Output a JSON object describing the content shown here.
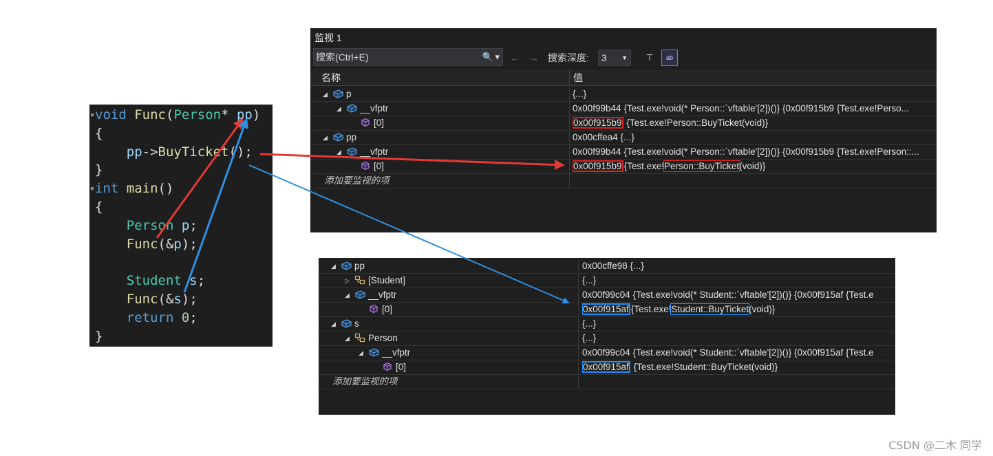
{
  "code": {
    "lines": [
      [
        {
          "t": "void",
          "c": "kw"
        },
        {
          "t": " ",
          "c": "pl"
        },
        {
          "t": "Func",
          "c": "fn"
        },
        {
          "t": "(",
          "c": "pl"
        },
        {
          "t": "Person",
          "c": "ty"
        },
        {
          "t": "* ",
          "c": "pl"
        },
        {
          "t": "pp",
          "c": "vr"
        },
        {
          "t": ")",
          "c": "pl"
        }
      ],
      [
        {
          "t": "{",
          "c": "pl"
        }
      ],
      [
        {
          "t": "    ",
          "c": "pl"
        },
        {
          "t": "pp",
          "c": "vr"
        },
        {
          "t": "->",
          "c": "pl"
        },
        {
          "t": "BuyTicket",
          "c": "fn"
        },
        {
          "t": "();",
          "c": "pl"
        }
      ],
      [
        {
          "t": "}",
          "c": "pl"
        }
      ],
      [
        {
          "t": "int",
          "c": "kw"
        },
        {
          "t": " ",
          "c": "pl"
        },
        {
          "t": "main",
          "c": "fn"
        },
        {
          "t": "()",
          "c": "pl"
        }
      ],
      [
        {
          "t": "{",
          "c": "pl"
        }
      ],
      [
        {
          "t": "    ",
          "c": "pl"
        },
        {
          "t": "Person",
          "c": "ty"
        },
        {
          "t": " ",
          "c": "pl"
        },
        {
          "t": "p",
          "c": "vr"
        },
        {
          "t": ";",
          "c": "pl"
        }
      ],
      [
        {
          "t": "    ",
          "c": "pl"
        },
        {
          "t": "Func",
          "c": "fn"
        },
        {
          "t": "(&",
          "c": "pl"
        },
        {
          "t": "p",
          "c": "vr"
        },
        {
          "t": ");",
          "c": "pl"
        }
      ],
      [],
      [
        {
          "t": "    ",
          "c": "pl"
        },
        {
          "t": "Student",
          "c": "ty"
        },
        {
          "t": " ",
          "c": "pl"
        },
        {
          "t": "s",
          "c": "vr"
        },
        {
          "t": ";",
          "c": "pl"
        }
      ],
      [
        {
          "t": "    ",
          "c": "pl"
        },
        {
          "t": "Func",
          "c": "fn"
        },
        {
          "t": "(&",
          "c": "pl"
        },
        {
          "t": "s",
          "c": "vr"
        },
        {
          "t": ");",
          "c": "pl"
        }
      ],
      [
        {
          "t": "    ",
          "c": "pl"
        },
        {
          "t": "return",
          "c": "kw"
        },
        {
          "t": " ",
          "c": "pl"
        },
        {
          "t": "0",
          "c": "nm"
        },
        {
          "t": ";",
          "c": "pl"
        }
      ],
      [
        {
          "t": "}",
          "c": "pl"
        }
      ]
    ]
  },
  "watch1": {
    "title": "监视 1",
    "search_placeholder": "搜索(Ctrl+E)",
    "search_icon": "search-icon",
    "depth_label": "搜索深度:",
    "depth_value": "3",
    "col_name": "名称",
    "col_value": "值",
    "rows": [
      {
        "indent": 1,
        "expand": "open",
        "icon": "object",
        "name": "p",
        "value": "{...}"
      },
      {
        "indent": 2,
        "expand": "open",
        "icon": "object",
        "name": "__vfptr",
        "value": "0x00f99b44 {Test.exe!void(* Person::`vftable'[2])()} {0x00f915b9 {Test.exe!Perso..."
      },
      {
        "indent": 3,
        "expand": "none",
        "icon": "field",
        "name": "[0]",
        "addr": "0x00f915b9",
        "rest": "{Test.exe!Person::BuyTicket(void)}",
        "box": "red"
      },
      {
        "indent": 1,
        "expand": "open",
        "icon": "object",
        "name": "pp",
        "value": "0x00cffea4 {...}"
      },
      {
        "indent": 2,
        "expand": "open",
        "icon": "object",
        "name": "__vfptr",
        "value": "0x00f99b44 {Test.exe!void(* Person::`vftable'[2])()} {0x00f915b9 {Test.exe!Person::..."
      },
      {
        "indent": 3,
        "expand": "none",
        "icon": "field",
        "name": "[0]",
        "addr": "0x00f915b9",
        "pre": "{Test.exe!",
        "mid": "Person::BuyTicket",
        "post": "(void)}",
        "box": "red"
      }
    ],
    "add_item": "添加要监视的项"
  },
  "watch2": {
    "rows": [
      {
        "indent": 1,
        "expand": "open",
        "icon": "object",
        "name": "pp",
        "value": "0x00cffe98 {...}"
      },
      {
        "indent": 2,
        "expand": "closed",
        "icon": "base",
        "name": "[Student]",
        "value": "{...}"
      },
      {
        "indent": 2,
        "expand": "open",
        "icon": "object",
        "name": "__vfptr",
        "value": "0x00f99c04 {Test.exe!void(* Student::`vftable'[2])()} {0x00f915af {Test.e"
      },
      {
        "indent": 3,
        "expand": "none",
        "icon": "field",
        "name": "[0]",
        "addr": "0x00f915af",
        "pre": "{Test.exe!",
        "mid": "Student::BuyTicket",
        "post": "(void)}",
        "box": "blue"
      },
      {
        "indent": 1,
        "expand": "open",
        "icon": "object",
        "name": "s",
        "value": "{...}"
      },
      {
        "indent": 2,
        "expand": "open",
        "icon": "base",
        "name": "Person",
        "value": "{...}"
      },
      {
        "indent": 3,
        "expand": "open",
        "icon": "object",
        "name": "__vfptr",
        "value": "0x00f99c04 {Test.exe!void(* Student::`vftable'[2])()} {0x00f915af {Test.e"
      },
      {
        "indent": 4,
        "expand": "none",
        "icon": "field",
        "name": "[0]",
        "addr": "0x00f915af",
        "rest": "{Test.exe!Student::BuyTicket(void)}",
        "box": "blue"
      }
    ],
    "add_item": "添加要监视的项"
  },
  "colors": {
    "red": "#e53935",
    "blue": "#2f8fe0"
  },
  "watermark": "CSDN @二木 同学"
}
